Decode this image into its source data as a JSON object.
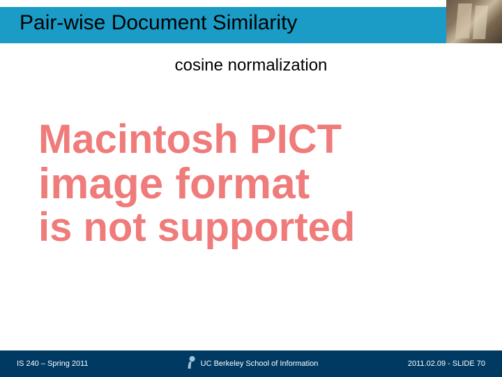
{
  "header": {
    "title": "Pair-wise Document Similarity"
  },
  "subtitle": "cosine normalization",
  "error": {
    "line1": "Macintosh PICT",
    "line2": "image format",
    "line3": "is not supported"
  },
  "footer": {
    "course": "IS 240 – Spring 2011",
    "institution": "UC Berkeley School of Information",
    "dateSlide": "2011.02.09 - SLIDE 70"
  }
}
